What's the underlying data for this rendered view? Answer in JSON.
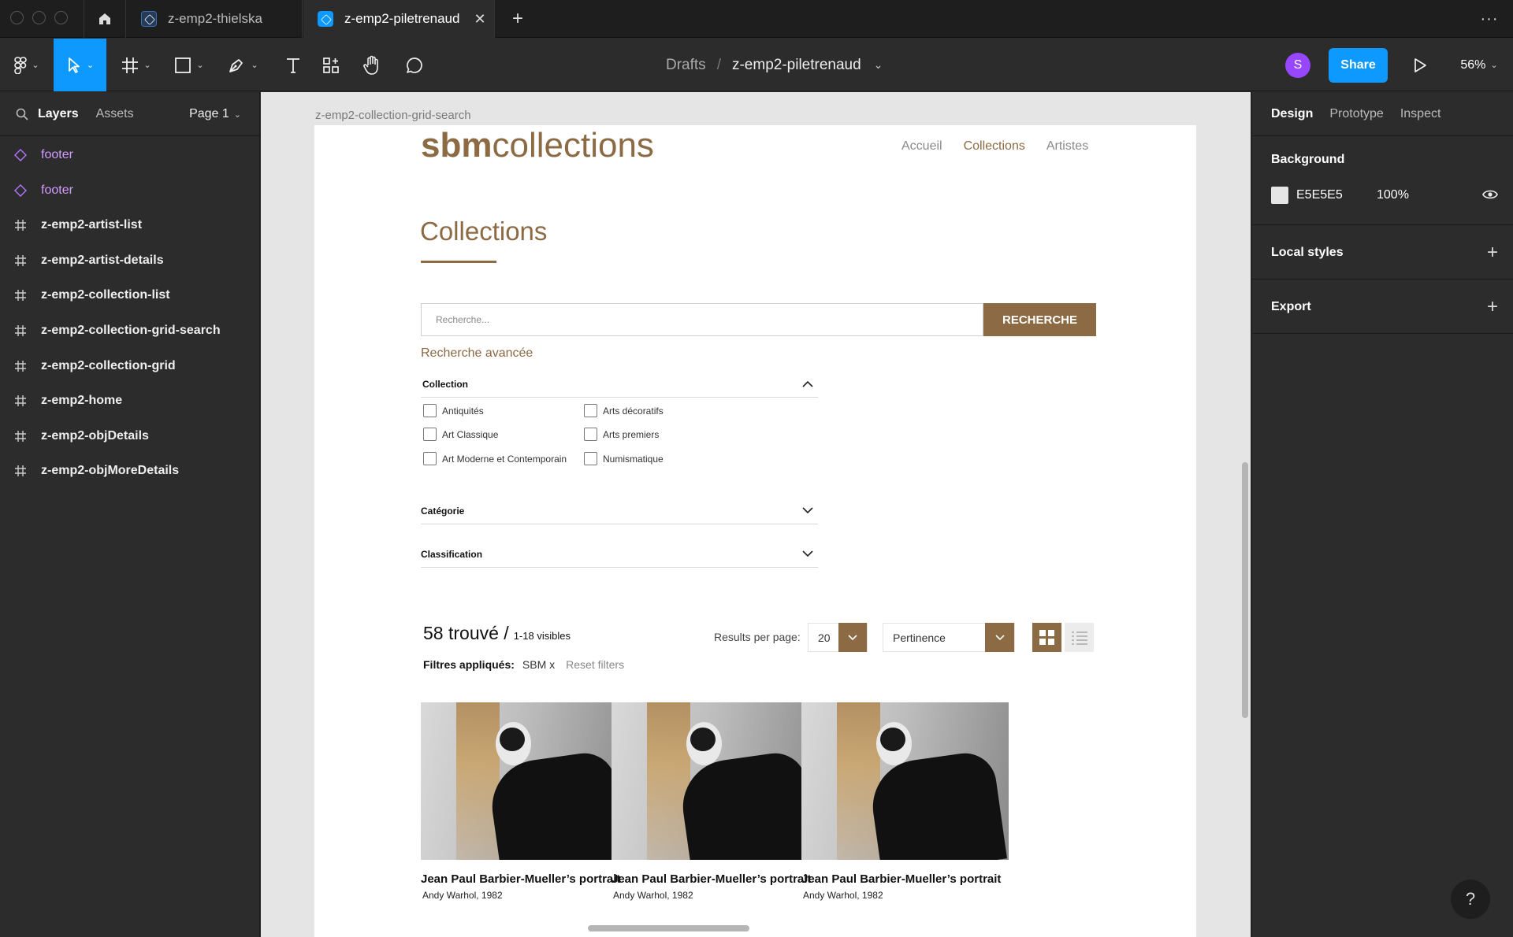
{
  "tabs": {
    "home_label": "Home",
    "items": [
      {
        "label": "z-emp2-thielska",
        "active": false
      },
      {
        "label": "z-emp2-piletrenaud",
        "active": true
      }
    ]
  },
  "toolbar": {
    "breadcrumb_root": "Drafts",
    "breadcrumb_sep": "/",
    "file_name": "z-emp2-piletrenaud",
    "avatar_initial": "S",
    "share_label": "Share",
    "zoom": "56%"
  },
  "left_panel": {
    "tab_layers": "Layers",
    "tab_assets": "Assets",
    "page_selector": "Page 1",
    "layers": [
      {
        "label": "footer",
        "type": "component"
      },
      {
        "label": "footer",
        "type": "component"
      },
      {
        "label": "z-emp2-artist-list",
        "type": "frame"
      },
      {
        "label": "z-emp2-artist-details",
        "type": "frame"
      },
      {
        "label": "z-emp2-collection-list",
        "type": "frame"
      },
      {
        "label": "z-emp2-collection-grid-search",
        "type": "frame"
      },
      {
        "label": "z-emp2-collection-grid",
        "type": "frame"
      },
      {
        "label": "z-emp2-home",
        "type": "frame"
      },
      {
        "label": "z-emp2-objDetails",
        "type": "frame"
      },
      {
        "label": "z-emp2-objMoreDetails",
        "type": "frame"
      }
    ]
  },
  "right_panel": {
    "tab_design": "Design",
    "tab_prototype": "Prototype",
    "tab_inspect": "Inspect",
    "background_label": "Background",
    "background_hex": "E5E5E5",
    "background_opacity": "100%",
    "local_styles_label": "Local styles",
    "export_label": "Export"
  },
  "canvas": {
    "frame_label": "z-emp2-collection-grid-search",
    "site": {
      "logo_bold": "sbm",
      "logo_light": "collections",
      "nav": [
        "Accueil",
        "Collections",
        "Artistes"
      ],
      "page_title": "Collections",
      "search_placeholder": "Recherche...",
      "search_button": "RECHERCHE",
      "advanced_search": "Recherche avancée",
      "filter_collection": "Collection",
      "collection_options": [
        "Antiquités",
        "Arts décoratifs",
        "Art Classique",
        "Arts premiers",
        "Art Moderne et Contemporain",
        "Numismatique"
      ],
      "filter_categorie": "Catégorie",
      "filter_classification": "Classification",
      "results_count": "58 trouvé /",
      "results_visible": "1-18 visibles",
      "results_per_page_label": "Results per page:",
      "results_per_page_value": "20",
      "sort_value": "Pertinence",
      "applied_filters_label": "Filtres appliqués:",
      "applied_filter": "SBM x",
      "reset_filters": "Reset filters",
      "cards": [
        {
          "title": "Jean Paul Barbier-Mueller’s portrait",
          "subtitle": "Andy Warhol, 1982"
        },
        {
          "title": "Jean Paul Barbier-Mueller’s portrait",
          "subtitle": "Andy Warhol, 1982"
        },
        {
          "title": "Jean Paul Barbier-Mueller’s portrait",
          "subtitle": "Andy Warhol, 1982"
        }
      ]
    }
  },
  "help_label": "?",
  "colors": {
    "accent_blue": "#0d99ff",
    "brand_brown": "#8c6a44",
    "component_purple": "#b676ff",
    "avatar_purple": "#9747ff"
  }
}
